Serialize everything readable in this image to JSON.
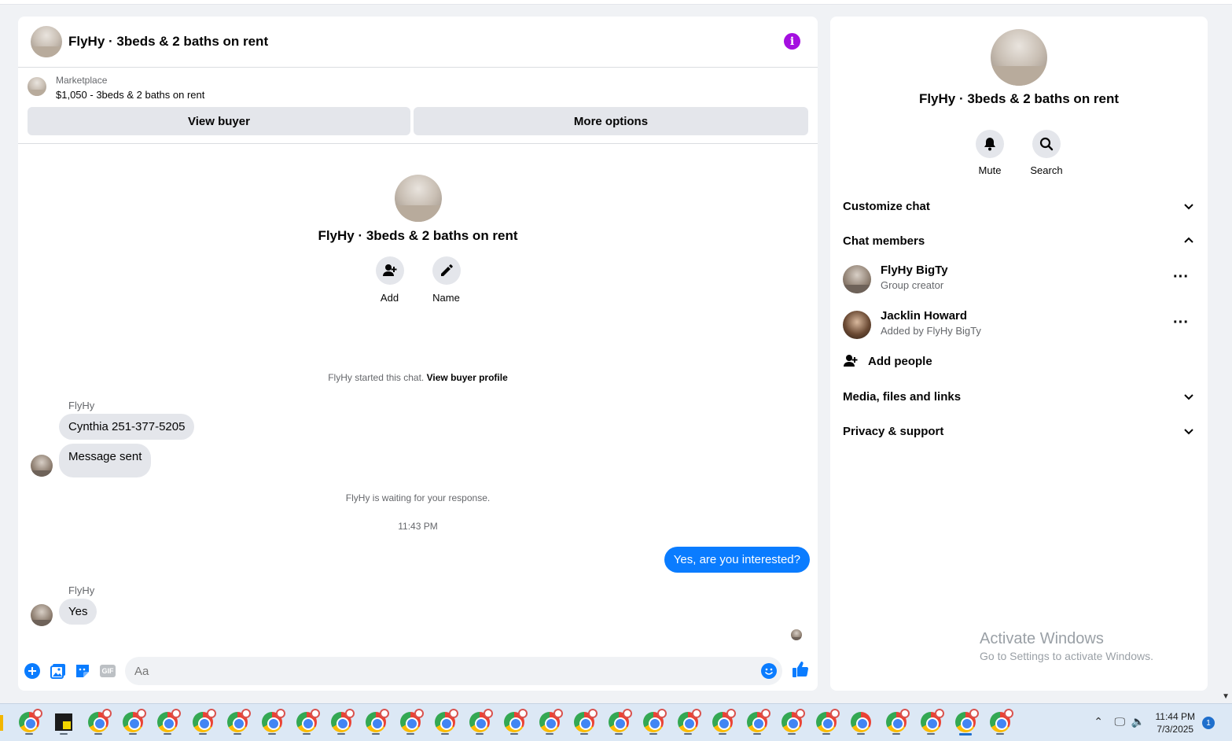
{
  "header": {
    "title": "FlyHy · 3beds & 2 baths on rent"
  },
  "marketplace": {
    "label": "Marketplace",
    "listing": "$1,050 - 3beds & 2 baths on rent",
    "view_buyer": "View buyer",
    "more_options": "More options"
  },
  "intro": {
    "title": "FlyHy · 3beds & 2 baths on rent",
    "add_label": "Add",
    "name_label": "Name"
  },
  "messages": {
    "started": "FlyHy started this chat.",
    "view_buyer_profile": "View buyer profile",
    "sender1": "FlyHy",
    "msg1": "Cynthia 251-377-5205",
    "msg2": "Message sent",
    "waiting": "FlyHy is waiting for your response.",
    "time": "11:43 PM",
    "outgoing": "Yes, are you interested?",
    "sender2": "FlyHy",
    "msg3": "Yes"
  },
  "composer": {
    "placeholder": "Aa",
    "gif": "GIF"
  },
  "side": {
    "title": "FlyHy · 3beds & 2 baths on rent",
    "mute": "Mute",
    "search": "Search",
    "customize": "Customize chat",
    "members_heading": "Chat members",
    "members": [
      {
        "name": "FlyHy BigTy",
        "sub": "Group creator"
      },
      {
        "name": "Jacklin Howard",
        "sub": "Added by FlyHy BigTy"
      }
    ],
    "add_people": "Add people",
    "media": "Media, files and links",
    "privacy": "Privacy & support"
  },
  "watermark": {
    "line1": "Activate Windows",
    "line2": "Go to Settings to activate Windows."
  },
  "taskbar": {
    "time": "11:44 PM",
    "date": "7/3/2025",
    "notifications": "1"
  },
  "colors": {
    "accent": "#0a7cff",
    "info": "#a40fe0",
    "bubble_in": "#e4e6eb"
  }
}
